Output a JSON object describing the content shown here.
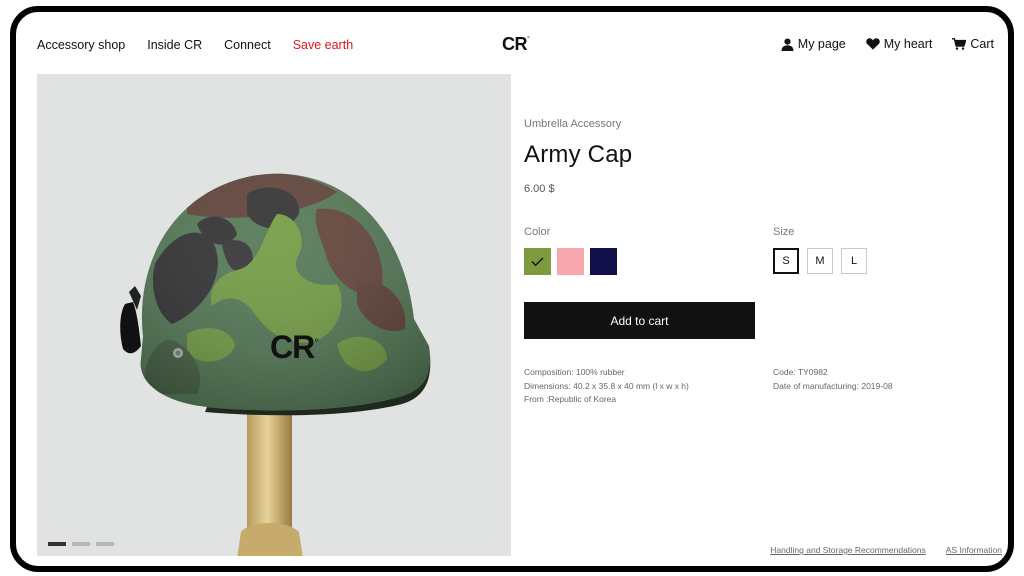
{
  "nav": {
    "links": [
      "Accessory shop",
      "Inside CR",
      "Connect",
      "Save earth"
    ],
    "logo": "CR",
    "logo_mark": "°",
    "my_page": "My page",
    "my_heart": "My heart",
    "cart": "Cart",
    "highlight_color": "#e0161b"
  },
  "gallery": {
    "helmet_print": "CR",
    "helmet_print_mark": "°",
    "slides": 3,
    "active_slide": 1
  },
  "product": {
    "category": "Umbrella Accessory",
    "name": "Army Cap",
    "price": "6.00 $",
    "color_label": "Color",
    "colors": [
      {
        "hex": "#7d9a3f",
        "selected": true
      },
      {
        "hex": "#f6a7ad",
        "selected": false
      },
      {
        "hex": "#12104a",
        "selected": false
      }
    ],
    "size_label": "Size",
    "sizes": [
      {
        "label": "S",
        "selected": true
      },
      {
        "label": "M",
        "selected": false
      },
      {
        "label": "L",
        "selected": false
      }
    ],
    "add_to_cart": "Add to cart",
    "composition": "Composition: 100% rubber",
    "dimensions": "Dimensions: 40.2 x 35.8 x 40 mm (l x w x h)",
    "origin": "From :Republic of Korea",
    "code": "Code: TY0982",
    "manufacturing": "Date of manufacturing: 2019-08"
  },
  "footer_links": {
    "handling": "Handling and Storage Recommendations",
    "as_info": "AS Information"
  }
}
